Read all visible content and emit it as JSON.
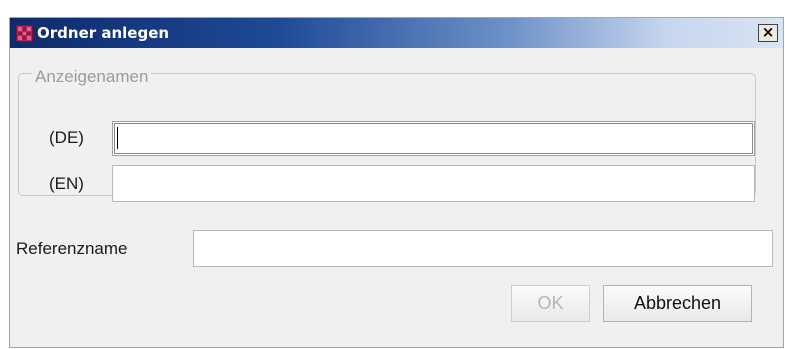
{
  "dialog": {
    "title": "Ordner anlegen",
    "close_glyph": "×",
    "icon": "app-icon"
  },
  "display_names": {
    "legend": "Anzeigenamen",
    "de_label": "(DE)",
    "de_value": "",
    "en_label": "(EN)",
    "en_value": ""
  },
  "reference": {
    "label": "Referenzname",
    "value": ""
  },
  "buttons": {
    "ok_label": "OK",
    "ok_enabled": false,
    "cancel_label": "Abbrechen"
  },
  "colors": {
    "titlebar_start": "#0e2a6b",
    "titlebar_end": "#d9e4f3",
    "dialog_background": "#f0f0f0",
    "icon_accent": "#b32658"
  }
}
